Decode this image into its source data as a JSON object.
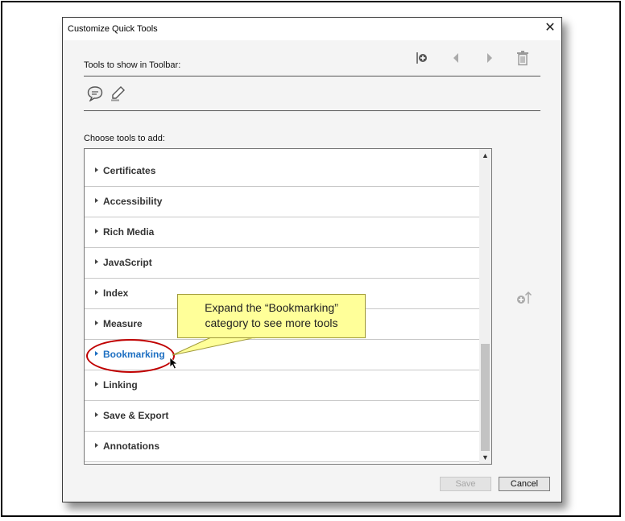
{
  "dialog": {
    "title": "Customize Quick Tools",
    "close_glyph": "✕",
    "toolbar_label": "Tools to show in Toolbar:",
    "choose_label": "Choose tools to add:"
  },
  "toolbar_actions": [
    "insert-separator-icon",
    "move-left-icon",
    "move-right-icon",
    "delete-icon"
  ],
  "toolbar_tools": [
    "comment-icon",
    "highlight-icon"
  ],
  "categories": [
    "Certificates",
    "Accessibility",
    "Rich Media",
    "JavaScript",
    "Index",
    "Measure",
    "Bookmarking",
    "Linking",
    "Save & Export",
    "Annotations"
  ],
  "highlighted_category": "Bookmarking",
  "callout": {
    "line1": "Expand the “Bookmarking”",
    "line2": "category to see more tools"
  },
  "buttons": {
    "save": "Save",
    "cancel": "Cancel"
  },
  "colors": {
    "highlight_text": "#1d6fc2",
    "callout_bg": "#ffff99",
    "ellipse": "#c00000"
  }
}
